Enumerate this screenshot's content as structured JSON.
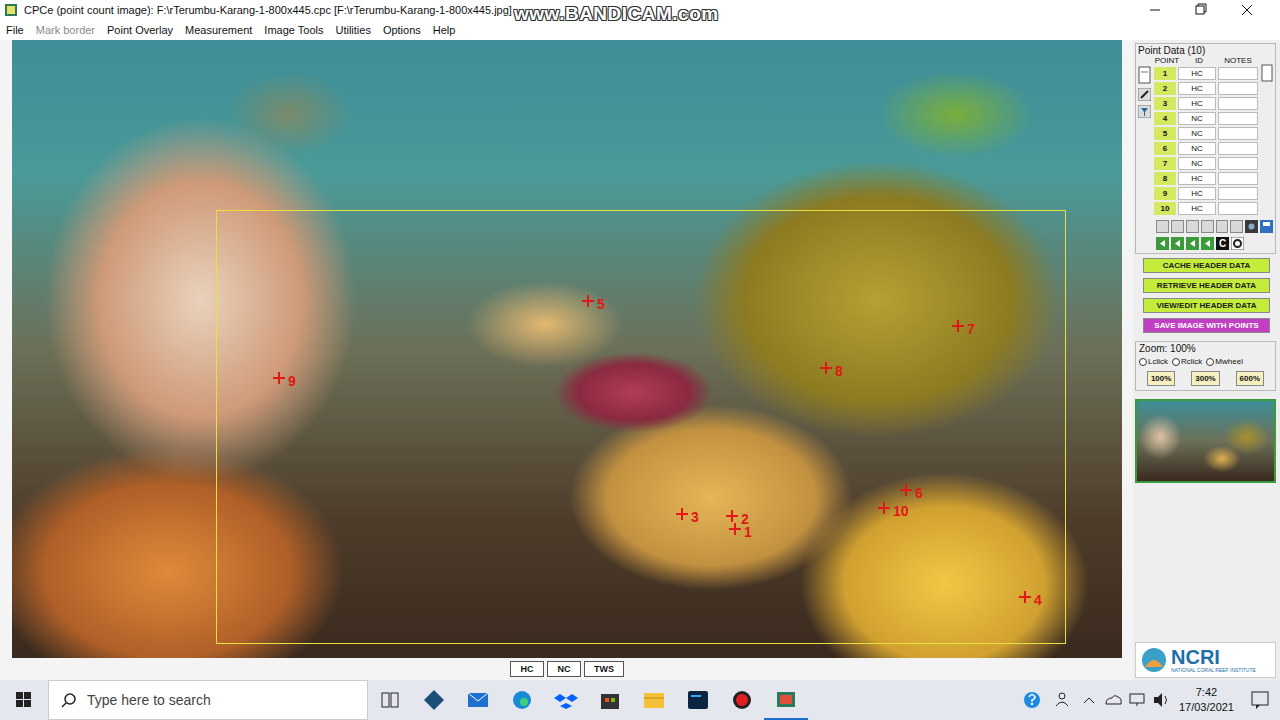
{
  "window": {
    "title": "CPCe (point count image): F:\\rTerumbu-Karang-1-800x445.cpc [F:\\rTerumbu-Karang-1-800x445.jpg]"
  },
  "watermark": "www.BANDICAM.com",
  "menu": [
    {
      "label": "File",
      "disabled": false
    },
    {
      "label": "Mark border",
      "disabled": true
    },
    {
      "label": "Point Overlay",
      "disabled": false
    },
    {
      "label": "Measurement",
      "disabled": false
    },
    {
      "label": "Image Tools",
      "disabled": false
    },
    {
      "label": "Utilities",
      "disabled": false
    },
    {
      "label": "Options",
      "disabled": false
    },
    {
      "label": "Help",
      "disabled": false
    }
  ],
  "image": {
    "points": [
      "1",
      "2",
      "3",
      "4",
      "5",
      "6",
      "7",
      "8",
      "9",
      "10"
    ]
  },
  "category_buttons": [
    "HC",
    "NC",
    "TWS"
  ],
  "point_data": {
    "title": "Point Data (10)",
    "columns": [
      "POINT",
      "ID",
      "NOTES"
    ],
    "rows": [
      {
        "point": "1",
        "id": "HC",
        "notes": ""
      },
      {
        "point": "2",
        "id": "HC",
        "notes": ""
      },
      {
        "point": "3",
        "id": "HC",
        "notes": ""
      },
      {
        "point": "4",
        "id": "NC",
        "notes": ""
      },
      {
        "point": "5",
        "id": "NC",
        "notes": ""
      },
      {
        "point": "6",
        "id": "NC",
        "notes": ""
      },
      {
        "point": "7",
        "id": "NC",
        "notes": ""
      },
      {
        "point": "8",
        "id": "HC",
        "notes": ""
      },
      {
        "point": "9",
        "id": "HC",
        "notes": ""
      },
      {
        "point": "10",
        "id": "HC",
        "notes": ""
      }
    ]
  },
  "tool_label": "C",
  "header_buttons": [
    {
      "label": "CACHE HEADER DATA",
      "color": "#c4ec3a"
    },
    {
      "label": "RETRIEVE HEADER DATA",
      "color": "#c4ec3a"
    },
    {
      "label": "VIEW/EDIT HEADER DATA",
      "color": "#c4ec3a"
    },
    {
      "label": "SAVE IMAGE WITH POINTS",
      "color": "#c23fc4"
    }
  ],
  "zoom": {
    "title": "Zoom: 100%",
    "modes": [
      "Lclick",
      "Rclick",
      "Mwheel"
    ],
    "presets": [
      "100%",
      "300%",
      "600%"
    ]
  },
  "logo": {
    "name": "NCRI",
    "subtitle": "NATIONAL CORAL REEF INSTITUTE"
  },
  "taskbar": {
    "search_placeholder": "Type here to search",
    "time": "7:42",
    "date": "17/03/2021"
  }
}
